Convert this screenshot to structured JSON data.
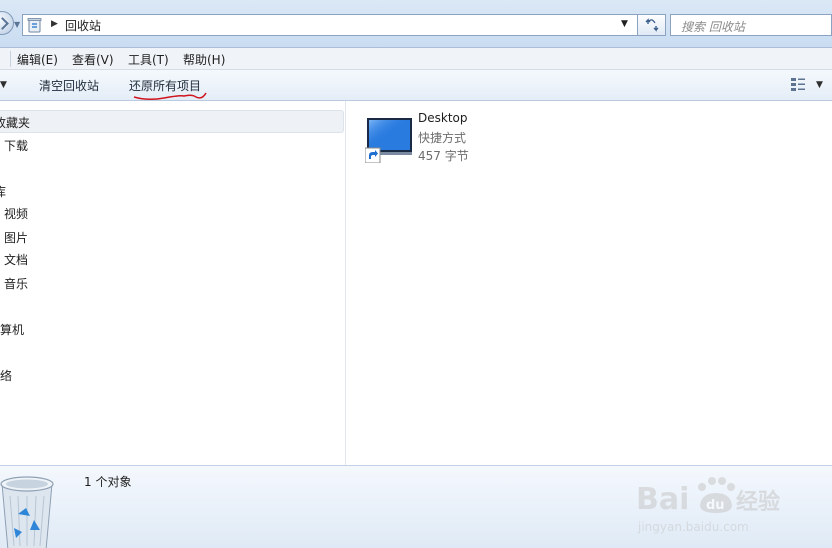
{
  "address_bar": {
    "path": "回收站",
    "search_placeholder": "搜索 回收站"
  },
  "menu": [
    {
      "label": "编辑(E)"
    },
    {
      "label": "查看(V)"
    },
    {
      "label": "工具(T)"
    },
    {
      "label": "帮助(H)"
    }
  ],
  "commands": {
    "empty_bin": "清空回收站",
    "restore_all": "还原所有项目"
  },
  "nav_pane": {
    "favorites": "收藏夹",
    "downloads": "下载",
    "libraries": "库",
    "videos": "视频",
    "pictures": "图片",
    "documents": "文档",
    "music": "音乐",
    "computer": "计算机",
    "network": "网络"
  },
  "files": [
    {
      "name": "Desktop",
      "type": "快捷方式",
      "size": "457 字节",
      "icon": "desktop-shortcut-icon"
    }
  ],
  "details_pane": {
    "item_count": "1 个对象"
  },
  "watermark": {
    "brand": "Baidu经验",
    "url": "jingyan.baidu.com"
  },
  "colors": {
    "annotation_underline": "#d0141e",
    "selection_bg": "#eef1f5",
    "accent_blue": "#1f6fd0"
  }
}
